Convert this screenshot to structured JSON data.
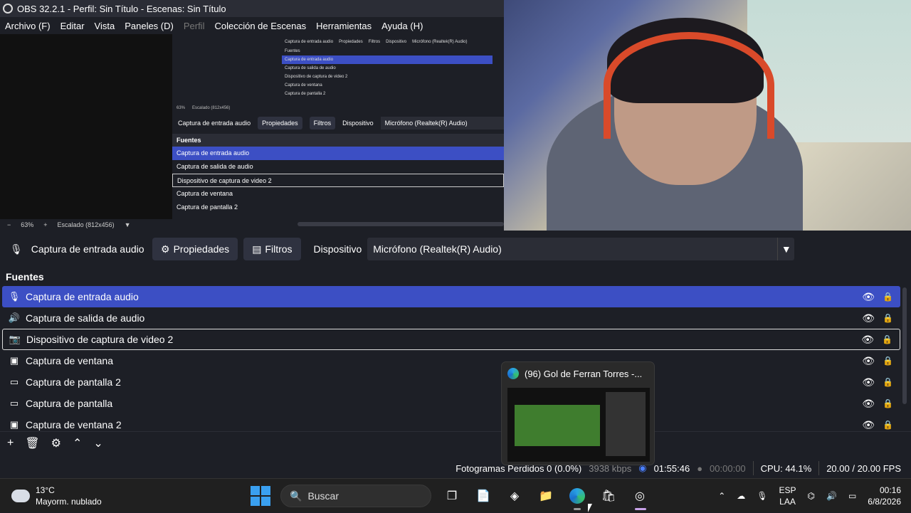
{
  "window": {
    "title": "OBS 32.2.1 - Perfil: Sin Título - Escenas: Sin Título"
  },
  "menu": [
    "Archivo (F)",
    "Editar",
    "Vista",
    "Paneles (D)",
    "Perfil",
    "Colección de Escenas",
    "Herramientas",
    "Ayuda (H)"
  ],
  "preview": {
    "zoom": "63%",
    "scale_label": "Escalado (812x456)"
  },
  "controls": {
    "source_name": "Captura de entrada audio",
    "properties_label": "Propiedades",
    "filters_label": "Filtros",
    "device_label": "Dispositivo",
    "device_value": "Micrófono (Realtek(R) Audio)"
  },
  "sources": {
    "header": "Fuentes",
    "items": [
      {
        "label": "Captura de entrada audio",
        "icon": "microphone-icon"
      },
      {
        "label": "Captura de salida de audio",
        "icon": "speaker-icon"
      },
      {
        "label": "Dispositivo de captura de video 2",
        "icon": "camera-icon"
      },
      {
        "label": "Captura de ventana",
        "icon": "window-icon"
      },
      {
        "label": "Captura de pantalla 2",
        "icon": "monitor-icon"
      },
      {
        "label": "Captura de pantalla",
        "icon": "monitor-icon"
      },
      {
        "label": "Captura de ventana 2",
        "icon": "window-icon"
      }
    ]
  },
  "status": {
    "dropped_frames": "Fotogramas Perdidos 0 (0.0%)",
    "bitrate": "3938 kbps",
    "rec_time": "01:55:46",
    "stream_time": "00:00:00",
    "cpu": "CPU: 44.1%",
    "fps": "20.00 / 20.00 FPS"
  },
  "thumbnail": {
    "title": "(96) Gol de Ferran Torres -..."
  },
  "taskbar": {
    "weather_temp": "13°C",
    "weather_desc": "Mayorm. nublado",
    "search_placeholder": "Buscar",
    "lang_top": "ESP",
    "lang_bottom": "LAA",
    "time": "00:16",
    "date": "6/8/2026"
  }
}
